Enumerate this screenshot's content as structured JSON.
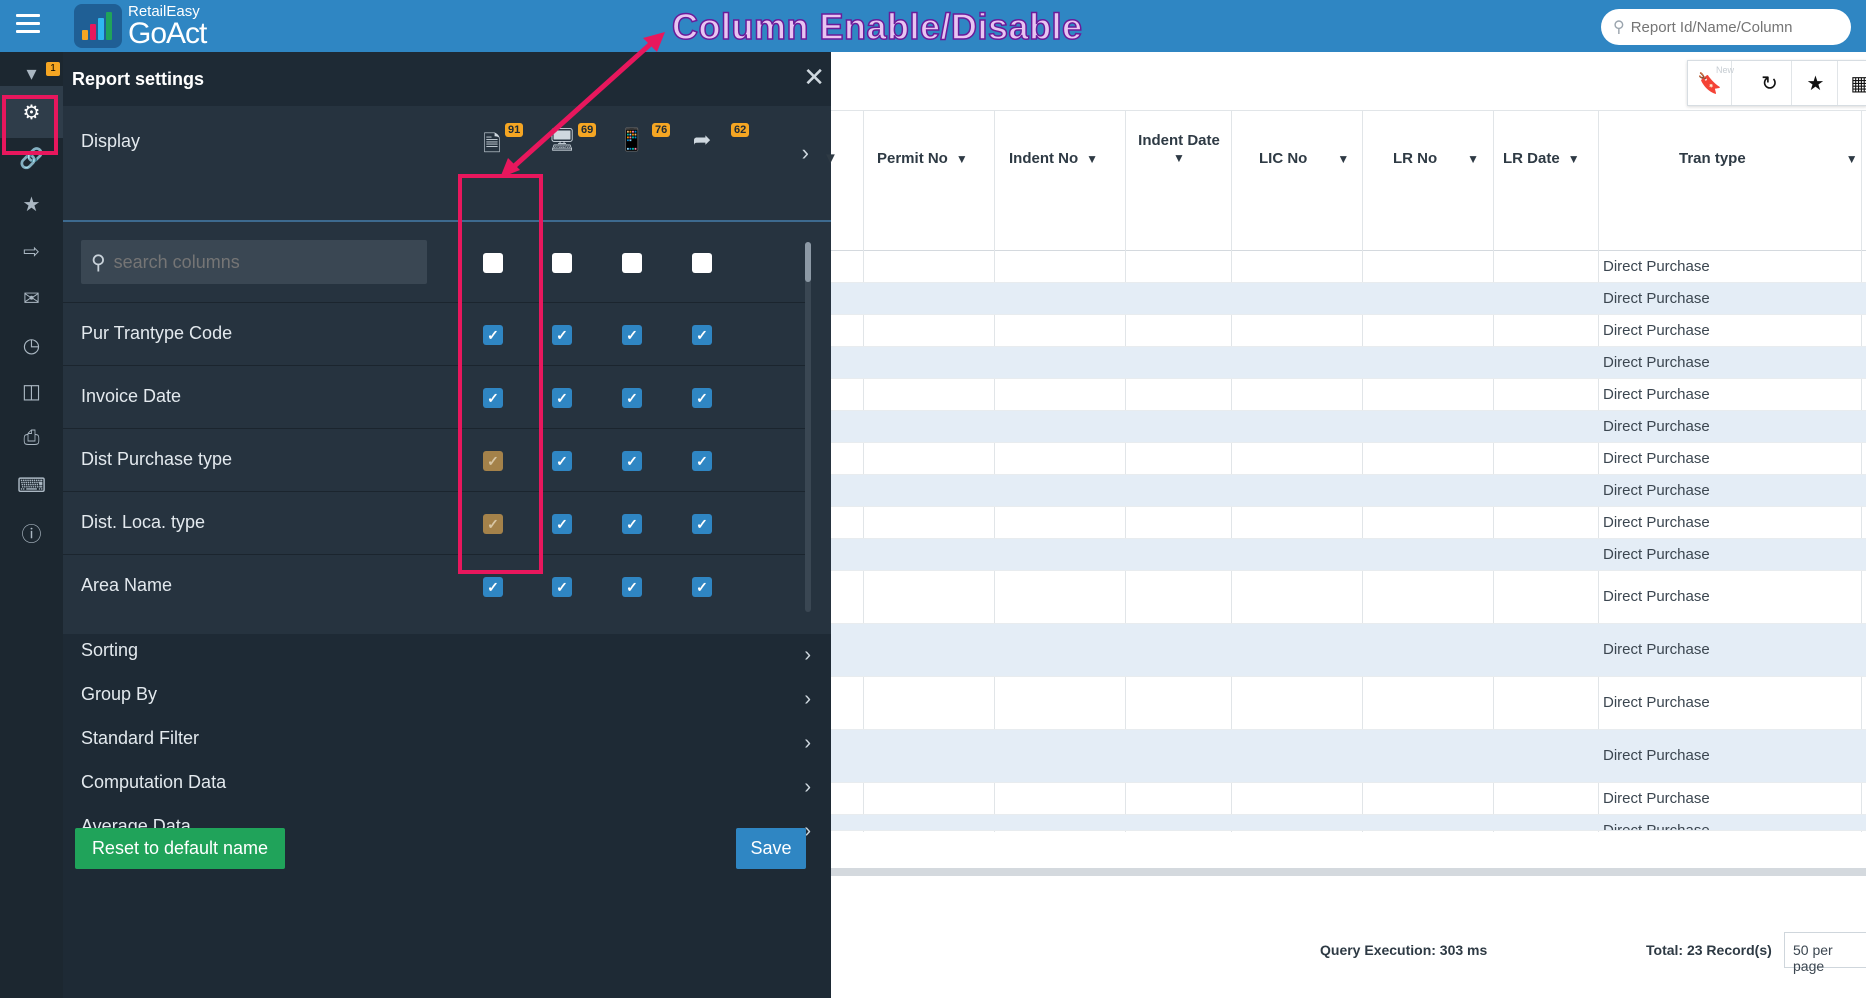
{
  "header": {
    "logo_small": "RetailEasy",
    "logo_big": "GoAct",
    "search_placeholder": "Report Id/Name/Column",
    "annotation": "Column Enable/Disable"
  },
  "rail": {
    "filter_badge": "1",
    "items": [
      "filter-icon",
      "gear-icon",
      "link-icon",
      "star-icon",
      "export-icon",
      "mail-icon",
      "clock-icon",
      "chart-icon",
      "print-icon",
      "keyboard-icon",
      "help-icon"
    ]
  },
  "panel": {
    "title": "Report settings",
    "display_label": "Display",
    "devices": [
      {
        "icon": "add-file-icon",
        "count": "91"
      },
      {
        "icon": "desktop-icon",
        "count": "69"
      },
      {
        "icon": "mobile-icon",
        "count": "76"
      },
      {
        "icon": "share-icon",
        "count": "62"
      }
    ],
    "search_placeholder": "search columns",
    "columns": [
      {
        "label": "Pur Trantype Code",
        "states": [
          "on",
          "on",
          "on",
          "on"
        ]
      },
      {
        "label": "Invoice Date",
        "states": [
          "on",
          "on",
          "on",
          "on"
        ]
      },
      {
        "label": "Dist Purchase type",
        "states": [
          "locked",
          "on",
          "on",
          "on"
        ]
      },
      {
        "label": "Dist. Loca. type",
        "states": [
          "locked",
          "on",
          "on",
          "on"
        ]
      },
      {
        "label": "Area Name",
        "states": [
          "on",
          "on",
          "on",
          "on"
        ]
      }
    ],
    "sections": [
      "Sorting",
      "Group By",
      "Standard Filter",
      "Computation Data",
      "Average Data"
    ],
    "reset_label": "Reset to default name",
    "save_label": "Save"
  },
  "report": {
    "toolbar_new": "New",
    "headers": [
      "Permit No",
      "Indent No",
      "Indent Date",
      "LIC No",
      "LR No",
      "LR Date",
      "Tran type"
    ],
    "rows": [
      "Direct Purchase",
      "Direct Purchase",
      "Direct Purchase",
      "Direct Purchase",
      "Direct Purchase",
      "Direct Purchase",
      "Direct Purchase",
      "Direct Purchase",
      "Direct Purchase",
      "Direct Purchase",
      "Direct Purchase",
      "Direct Purchase",
      "Direct Purchase",
      "Direct Purchase",
      "Direct Purchase",
      "Direct Purchase"
    ],
    "query_execution": "Query Execution: 303 ms",
    "total": "Total: 23 Record(s)",
    "per_page": "50 per page"
  },
  "colors": {
    "topbar": "#2f86c3",
    "panel": "#1e2a35",
    "checkbox_on": "#2f86c3",
    "checkbox_locked": "#a4824a",
    "highlight": "#e8175d",
    "reset_button": "#20a35a"
  }
}
